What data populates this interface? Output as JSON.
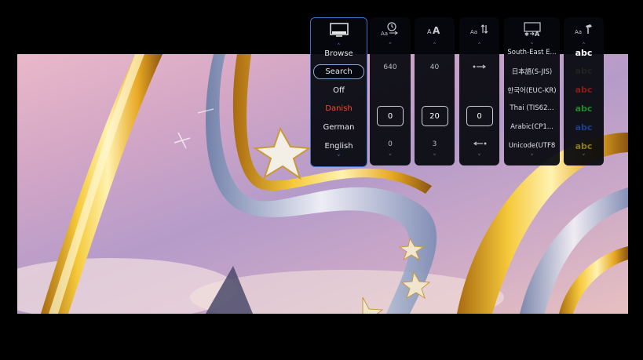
{
  "mode_panel": {
    "icon": "subtitle-screen-icon",
    "items": [
      "Browse",
      "Search",
      "Off",
      "Danish",
      "German",
      "English"
    ],
    "selected": "Search",
    "highlighted": "Danish",
    "highlight_color": "#e8512f"
  },
  "sync_panel": {
    "icon": "subtitle-sync-clock-icon",
    "top": "640",
    "value": "0",
    "bottom": "0"
  },
  "size_panel": {
    "icon": "font-size-icon",
    "top": "40",
    "value": "20",
    "bottom": "3"
  },
  "position_panel": {
    "icon": "vertical-position-icon",
    "top_icon": "arrow-right-icon",
    "value": "0",
    "bottom_icon": "arrow-left-icon"
  },
  "encoding_panel": {
    "icon": "encoding-icon",
    "items": [
      "South-East E...",
      "日本語(S-JIS)",
      "한국어(EUC-KR)",
      "Thai (TIS62...",
      "Arabic(CP1...",
      "Unicode(UTF8"
    ],
    "selected": "Unicode(UTF8"
  },
  "color_panel": {
    "icon": "text-color-icon",
    "samples": [
      {
        "label": "abc",
        "color": "#ffffff"
      },
      {
        "label": "abc",
        "color": "#222222"
      },
      {
        "label": "abc",
        "color": "#8b1b1b"
      },
      {
        "label": "abc",
        "color": "#1e8a2b"
      },
      {
        "label": "abc",
        "color": "#1e3d8a"
      },
      {
        "label": "abc",
        "color": "#8a7a1e"
      }
    ]
  }
}
